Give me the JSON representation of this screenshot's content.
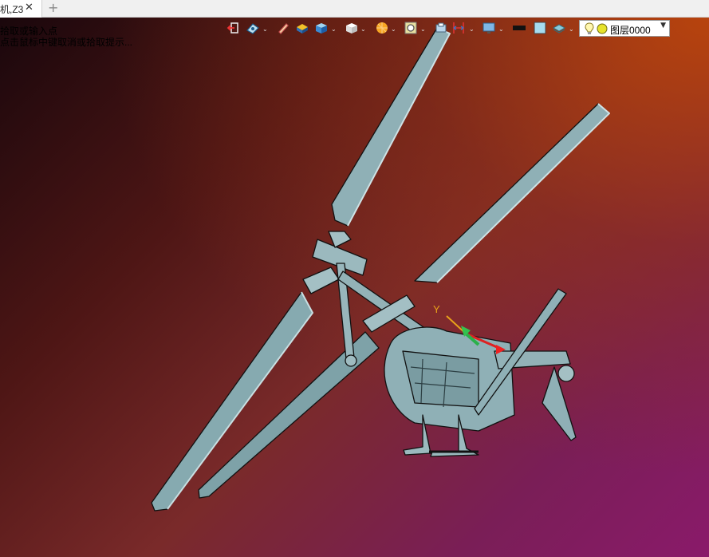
{
  "tab": {
    "title": "机,Z3",
    "close_glyph": "✕",
    "add_glyph": "+"
  },
  "viewport": {
    "hint_line1": "拾取或输入点",
    "hint_line2": "点击鼠标中键取消或拾取提示..."
  },
  "toolbar": {
    "icons": [
      "exit-view-icon",
      "view-orientation-icon",
      "pencil-icon",
      "shaded-solid-icon",
      "box-view-icon",
      "cube-view-icon",
      "render-mode-icon",
      "zoom-fit-icon",
      "section-view-icon",
      "dimension-icon",
      "display-settings-icon",
      "line-color-icon",
      "fill-color-icon",
      "layer-stack-icon"
    ],
    "layer_value": "图层0000"
  },
  "triad": {
    "y_label": "Y"
  },
  "colors": {
    "model": "#8fb0b6",
    "model_dark": "#3f5a60",
    "bg_top_left": "#1a070c",
    "bg_top_right": "#b8420c",
    "bg_bottom": "#8a1a6a"
  }
}
